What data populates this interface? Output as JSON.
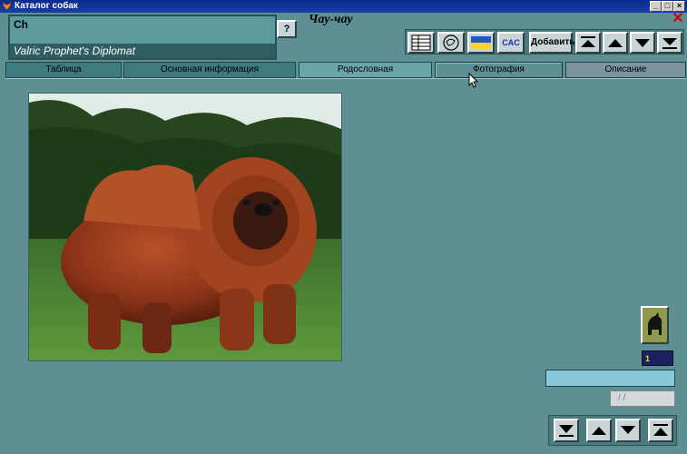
{
  "window": {
    "title": "Каталог собак"
  },
  "header": {
    "breed_code": "Ch",
    "dog_name": "Valric Prophet's Diplomat",
    "breed_title": "Чау-чау",
    "help_label": "?"
  },
  "toolbar": {
    "cac_label": "CAC",
    "add_label": "Добавить"
  },
  "tabs": [
    {
      "label": "Таблица"
    },
    {
      "label": "Основная информация"
    },
    {
      "label": "Родословная"
    },
    {
      "label": "Фотография"
    },
    {
      "label": "Описание"
    }
  ],
  "photo": {
    "counter": "1",
    "date_placeholder": "/ /"
  },
  "colors": {
    "title_bar": "#0a2a8c",
    "background": "#5e8f93",
    "counter_text": "#f2d44a"
  }
}
